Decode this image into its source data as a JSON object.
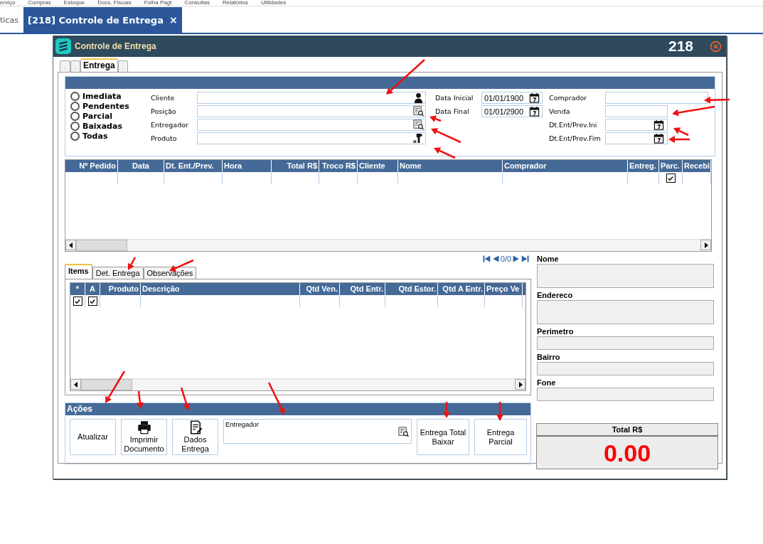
{
  "menu": [
    "erviço",
    "Compras",
    "Estoque",
    "Docs. Fiscais",
    "Folha Pagt",
    "Consultas",
    "Relatórios",
    "Utilidades"
  ],
  "app_tabs": [
    {
      "label": "ticas",
      "selected": false
    },
    {
      "label": "[218] Controle de Entrega",
      "selected": true,
      "close": "×"
    }
  ],
  "window": {
    "title": "Controle de Entrega",
    "number": "218"
  },
  "form_tabs": [
    {
      "label": ".",
      "selected": false
    },
    {
      "label": ".",
      "selected": false
    },
    {
      "label": "Entrega",
      "selected": true
    },
    {
      "label": ".",
      "selected": false
    }
  ],
  "filter": {
    "radios": [
      {
        "label": "Imediata",
        "selected": false
      },
      {
        "label": "Pendentes",
        "selected": false
      },
      {
        "label": "Parcial",
        "selected": false
      },
      {
        "label": "Baixadas",
        "selected": false
      },
      {
        "label": "Todas",
        "selected": false
      }
    ],
    "lookups": [
      {
        "label": "Cliente",
        "kind": "person"
      },
      {
        "label": "Posição",
        "kind": "lookup"
      },
      {
        "label": "Entregador",
        "kind": "lookup"
      },
      {
        "label": "Produto",
        "kind": "scanner"
      }
    ],
    "dates": [
      {
        "label": "Data Inicial",
        "value": "01/01/1900"
      },
      {
        "label": "Data Final",
        "value": "01/01/2900"
      }
    ],
    "extra": [
      {
        "label": "Comprador",
        "kind": "wide"
      },
      {
        "label": "Venda",
        "kind": "plain"
      },
      {
        "label": "Dt.Ent/Prev.Ini",
        "kind": "date"
      },
      {
        "label": "Dt.Ent/Prev.Fim",
        "kind": "date"
      }
    ]
  },
  "orders": {
    "columns": [
      "Nº Pedido",
      "Data",
      "Dt. Ent./Prev.",
      "Hora",
      "Total R$",
      "Troco R$",
      "Cliente",
      "Nome",
      "Comprador",
      "Entreg.",
      "Parc.",
      "Recebi"
    ],
    "rows": [
      {
        "parcial_checked": true
      }
    ],
    "navigator": "0/0"
  },
  "detail_tabs": [
    {
      "label": "Items",
      "selected": true
    },
    {
      "label": "Det. Entrega",
      "selected": false
    },
    {
      "label": "Observações",
      "selected": false
    }
  ],
  "items": {
    "columns": [
      "*",
      "A",
      "Produto",
      "Descrição",
      "Qtd Ven.",
      "Qtd Entr.",
      "Qtd Estor.",
      "Qtd A Entr.",
      "Preço Ve"
    ],
    "rows": [
      {
        "star_checked": true,
        "a_checked": true
      }
    ]
  },
  "customer": [
    {
      "label": "Nome",
      "kind": "tall"
    },
    {
      "label": "Endereco",
      "kind": "tall"
    },
    {
      "label": "Perimetro",
      "kind": "short"
    },
    {
      "label": "Bairro",
      "kind": "short"
    },
    {
      "label": "Fone",
      "kind": "short"
    }
  ],
  "actions": {
    "title": "Ações",
    "buttons": [
      {
        "label": "Atualizar",
        "kind": "plain"
      },
      {
        "label": "Imprimir Documento",
        "kind": "printer"
      },
      {
        "label": "Dados Entrega",
        "kind": "document"
      },
      {
        "label": "Entregador",
        "kind": "field"
      },
      {
        "label": "Entrega Total Baixar",
        "kind": "plain"
      },
      {
        "label": "Entrega Parcial",
        "kind": "plain"
      }
    ]
  },
  "total": {
    "label": "Total R$",
    "value": "0.00"
  }
}
